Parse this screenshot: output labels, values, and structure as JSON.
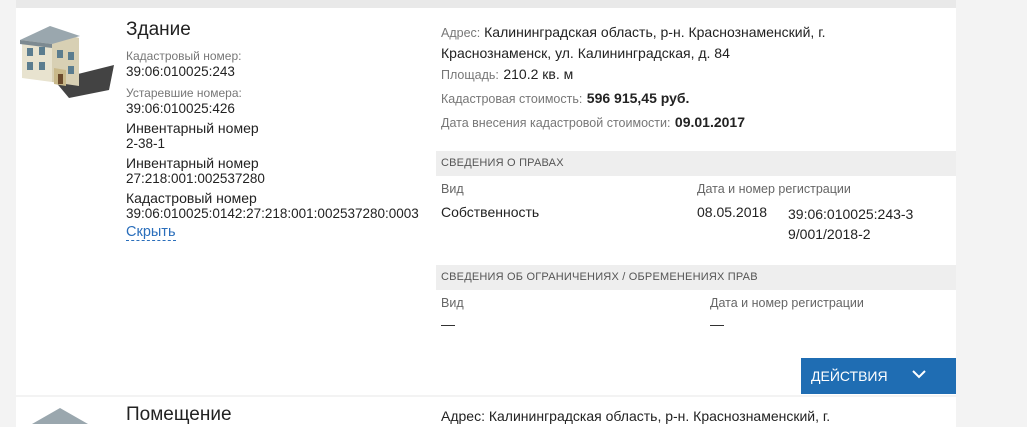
{
  "object": {
    "title": "Здание",
    "cadastral_label": "Кадастровый номер:",
    "cadastral_value": "39:06:010025:243",
    "old_label": "Устаревшие номера:",
    "old_value": "39:06:010025:426",
    "inv1_label": "Инвентарный номер",
    "inv1_value": "2-38-1",
    "inv2_label": "Инвентарный номер",
    "inv2_value": "27:218:001:002537280",
    "cad2_label": "Кадастровый номер",
    "cad2_value": "39:06:010025:0142:27:218:001:002537280:0003",
    "hide_link": "Скрыть"
  },
  "details": {
    "address_label": "Адрес:",
    "address_value": "Калининградская область, р-н. Краснознаменский, г. Краснознаменск, ул. Калининградская, д. 84",
    "area_label": "Площадь:",
    "area_value": "210.2 кв. м",
    "cost_label": "Кадастровая стоимость:",
    "cost_value": "596 915,45 руб.",
    "cost_date_label": "Дата внесения кадастровой стоимости:",
    "cost_date_value": "09.01.2017"
  },
  "rights": {
    "section_title": "СВЕДЕНИЯ О ПРАВАХ",
    "col_kind": "Вид",
    "col_reg": "Дата и номер регистрации",
    "kind_value": "Собственность",
    "reg_date": "08.05.2018",
    "reg_number": "39:06:010025:243-39/001/2018-2"
  },
  "restrictions": {
    "section_title": "СВЕДЕНИЯ ОБ ОГРАНИЧЕНИЯХ / ОБРЕМЕНЕНИЯХ ПРАВ",
    "col_kind": "Вид",
    "col_reg": "Дата и номер регистрации",
    "kind_value": "—",
    "reg_value": "—"
  },
  "actions": {
    "label": "ДЕЙСТВИЯ",
    "icon": "chevron-down-icon"
  },
  "next_item": {
    "title": "Помещение",
    "address_fragment": "Адрес: Калининградская область, р-н. Краснознаменский, г."
  },
  "colors": {
    "accent": "#1f6db3",
    "link": "#2a6ebb",
    "section_bg": "#eeeeee"
  }
}
